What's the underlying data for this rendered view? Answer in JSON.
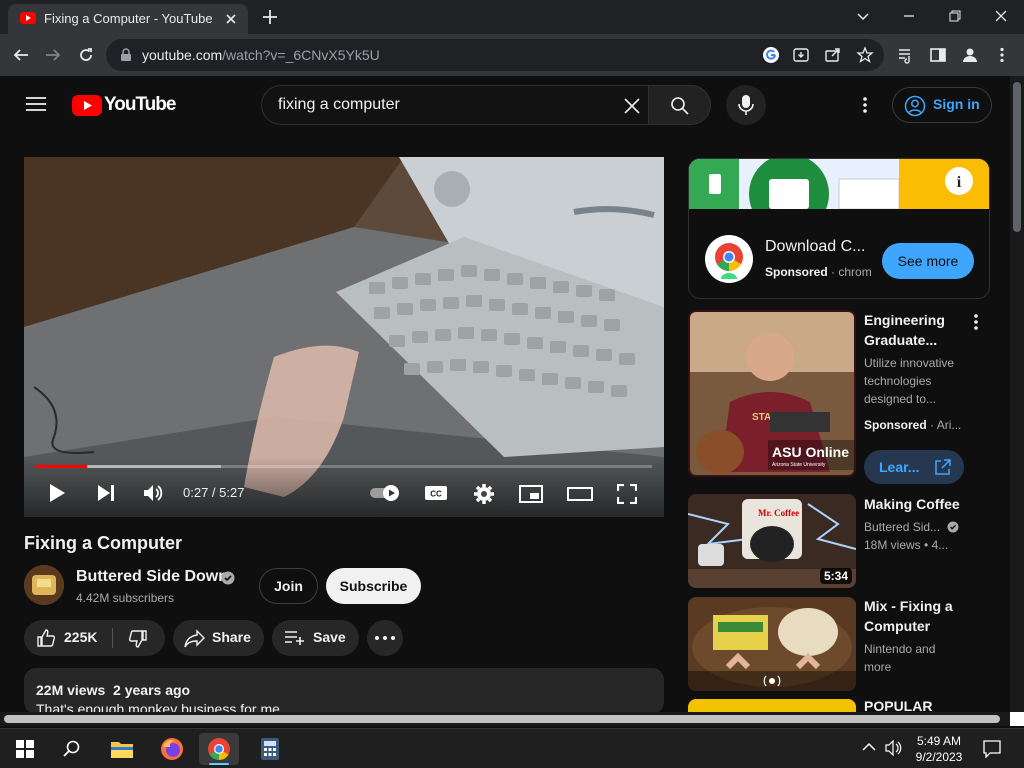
{
  "browser": {
    "tab_title": "Fixing a Computer - YouTube",
    "url_host": "youtube.com",
    "url_path": "/watch?v=_6CNvX5Yk5U"
  },
  "header": {
    "logo_text": "YouTube",
    "search_value": "fixing a computer",
    "sign_in_label": "Sign in"
  },
  "player": {
    "time_display": "0:27 / 5:27",
    "progress_played": 0.083,
    "progress_buffered": 0.3
  },
  "video": {
    "title": "Fixing a Computer",
    "channel_name": "Buttered Side Down",
    "subscribers": "4.42M subscribers",
    "join_label": "Join",
    "subscribe_label": "Subscribe",
    "like_count": "225K",
    "share_label": "Share",
    "save_label": "Save",
    "views": "22M views",
    "age": "2 years ago",
    "description": "That's enough monkey business for me."
  },
  "sidebar": {
    "ad": {
      "title": "Download C...",
      "sponsored_label": "Sponsored",
      "sponsor_source": "chrom",
      "cta_label": "See more"
    },
    "items": [
      {
        "title_line1": "Engineering",
        "title_line2": "Graduate...",
        "desc_line1": "Utilize innovative",
        "desc_line2": "technologies",
        "desc_line3": "designed to...",
        "sponsored_label": "Sponsored",
        "advertiser": "Ari...",
        "cta_label": "Lear...",
        "thumb_brand": "ASU Online",
        "thumb_sub": "Arizona State University"
      },
      {
        "title": "Making Coffee",
        "channel": "Buttered Sid...",
        "views": "18M views",
        "age_trunc": "4...",
        "duration": "5:34",
        "thumb_label": "Mr. Coffee"
      },
      {
        "title_line1": "Mix - Fixing a",
        "title_line2": "Computer",
        "desc_line1": "Nintendo and",
        "desc_line2": "more"
      },
      {
        "title": "POPULAR"
      }
    ]
  },
  "taskbar": {
    "time": "5:49 AM",
    "date": "9/2/2023"
  },
  "colors": {
    "youtube_red": "#ff0000",
    "link_blue": "#3ea6ff",
    "page_bg": "#0f0f0f"
  }
}
